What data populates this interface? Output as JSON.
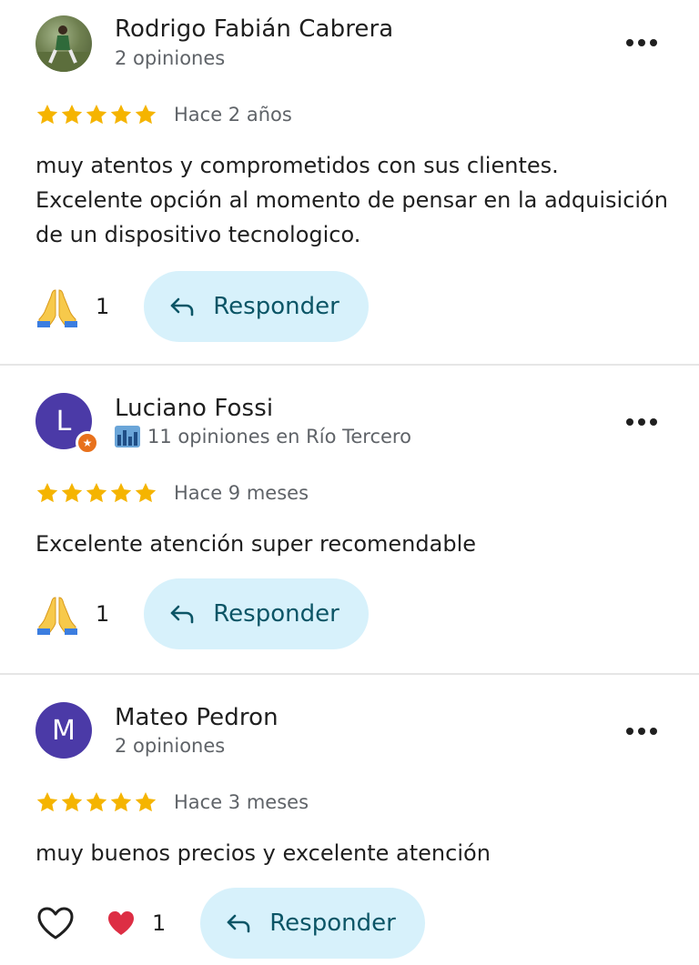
{
  "reviews": [
    {
      "author": "Rodrigo Fabián Cabrera",
      "meta": "2 opiniones",
      "rating": 5,
      "date": "Hace 2 años",
      "text": "muy atentos y comprometidos con sus clientes. Excelente opción al momento de pensar en la adquisición de un dispositivo tecnologico.",
      "reaction_count": "1",
      "reply_label": "Responder"
    },
    {
      "author": "Luciano Fossi",
      "avatar_letter": "L",
      "meta": "11 opiniones en Río Tercero",
      "rating": 5,
      "date": "Hace 9 meses",
      "text": "Excelente atención super recomendable",
      "reaction_count": "1",
      "reply_label": "Responder"
    },
    {
      "author": "Mateo Pedron",
      "avatar_letter": "M",
      "meta": "2 opiniones",
      "rating": 5,
      "date": "Hace 3 meses",
      "text": "muy buenos precios y excelente atención",
      "reaction_count": "1",
      "reply_label": "Responder"
    }
  ],
  "colors": {
    "star": "#f5b400",
    "reply_bg": "#d7f1fb",
    "reply_text": "#0b5566",
    "avatar_purple": "#4b3aa7",
    "guide_badge": "#e8711c"
  },
  "icons": {
    "reaction_review_1": "folded-hands-emoji",
    "reaction_review_2": "folded-hands-emoji",
    "reaction_review_3": "red-heart-emoji",
    "like": "heart-outline-icon",
    "reply": "reply-arrow-icon",
    "more": "more-horizontal-icon"
  }
}
